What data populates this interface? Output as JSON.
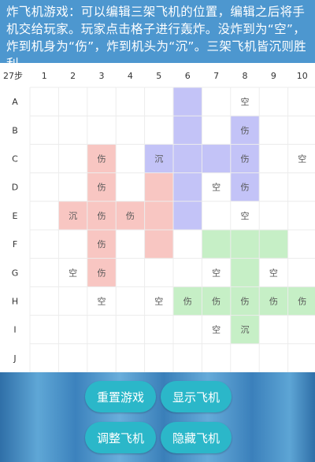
{
  "instructions": "炸飞机游戏：可以编辑三架飞机的位置，编辑之后将手机交给玩家。玩家点击格子进行轰炸。没炸到为“空”，炸到机身为“伤”，炸到机头为“沉”。三架飞机皆沉则胜利。",
  "board": {
    "step_label": "27步",
    "columns": [
      "1",
      "2",
      "3",
      "4",
      "5",
      "6",
      "7",
      "8",
      "9",
      "10"
    ],
    "rows": [
      "A",
      "B",
      "C",
      "D",
      "E",
      "F",
      "G",
      "H",
      "I",
      "J"
    ],
    "planes": [
      {
        "name": "blue",
        "color": "#c3c3f7",
        "cells": [
          [
            0,
            5
          ],
          [
            1,
            5
          ],
          [
            2,
            4
          ],
          [
            2,
            5
          ],
          [
            2,
            6
          ],
          [
            2,
            7
          ],
          [
            3,
            5
          ],
          [
            4,
            5
          ],
          [
            1,
            7
          ],
          [
            3,
            7
          ]
        ]
      },
      {
        "name": "pink",
        "color": "#f8c6c2",
        "cells": [
          [
            2,
            2
          ],
          [
            3,
            2
          ],
          [
            4,
            1
          ],
          [
            4,
            2
          ],
          [
            4,
            3
          ],
          [
            5,
            2
          ],
          [
            6,
            2
          ],
          [
            3,
            4
          ],
          [
            4,
            4
          ],
          [
            5,
            4
          ]
        ]
      },
      {
        "name": "green",
        "color": "#c6efc6",
        "cells": [
          [
            5,
            6
          ],
          [
            5,
            7
          ],
          [
            5,
            8
          ],
          [
            6,
            7
          ],
          [
            7,
            5
          ],
          [
            7,
            6
          ],
          [
            7,
            7
          ],
          [
            7,
            8
          ],
          [
            7,
            9
          ],
          [
            8,
            7
          ]
        ]
      }
    ],
    "marks": [
      {
        "row": 0,
        "col": 7,
        "text": "空"
      },
      {
        "row": 1,
        "col": 7,
        "text": "伤"
      },
      {
        "row": 2,
        "col": 2,
        "text": "伤"
      },
      {
        "row": 2,
        "col": 4,
        "text": "沉"
      },
      {
        "row": 2,
        "col": 7,
        "text": "伤"
      },
      {
        "row": 2,
        "col": 9,
        "text": "空"
      },
      {
        "row": 3,
        "col": 2,
        "text": "伤"
      },
      {
        "row": 3,
        "col": 6,
        "text": "空"
      },
      {
        "row": 3,
        "col": 7,
        "text": "伤"
      },
      {
        "row": 4,
        "col": 1,
        "text": "沉"
      },
      {
        "row": 4,
        "col": 2,
        "text": "伤"
      },
      {
        "row": 4,
        "col": 3,
        "text": "伤"
      },
      {
        "row": 4,
        "col": 7,
        "text": "空"
      },
      {
        "row": 5,
        "col": 2,
        "text": "伤"
      },
      {
        "row": 6,
        "col": 1,
        "text": "空"
      },
      {
        "row": 6,
        "col": 2,
        "text": "伤"
      },
      {
        "row": 6,
        "col": 6,
        "text": "空"
      },
      {
        "row": 6,
        "col": 8,
        "text": "空"
      },
      {
        "row": 7,
        "col": 2,
        "text": "空"
      },
      {
        "row": 7,
        "col": 4,
        "text": "空"
      },
      {
        "row": 7,
        "col": 5,
        "text": "伤"
      },
      {
        "row": 7,
        "col": 6,
        "text": "伤"
      },
      {
        "row": 7,
        "col": 7,
        "text": "伤"
      },
      {
        "row": 7,
        "col": 8,
        "text": "伤"
      },
      {
        "row": 7,
        "col": 9,
        "text": "伤"
      },
      {
        "row": 8,
        "col": 6,
        "text": "空"
      },
      {
        "row": 8,
        "col": 7,
        "text": "沉"
      }
    ]
  },
  "buttons": {
    "reset": "重置游戏",
    "show": "显示飞机",
    "adjust": "调整飞机",
    "hide": "隐藏飞机"
  }
}
